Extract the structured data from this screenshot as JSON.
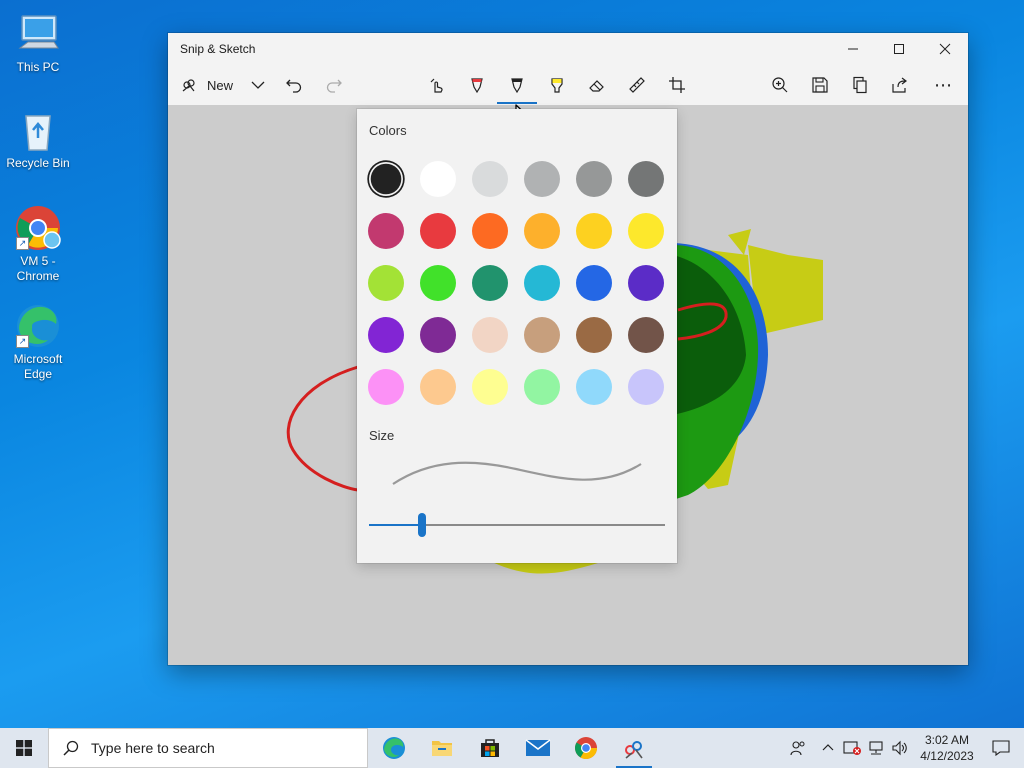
{
  "desktop": {
    "icons": [
      {
        "label": "This PC"
      },
      {
        "label": "Recycle Bin"
      },
      {
        "label": "VM 5 - Chrome"
      },
      {
        "label": "Microsoft Edge"
      }
    ]
  },
  "window": {
    "title": "Snip & Sketch",
    "toolbar": {
      "new_label": "New",
      "more_label": "⋯"
    }
  },
  "flyout": {
    "colors_label": "Colors",
    "size_label": "Size",
    "selected_color": "#222222",
    "size_level": 0.18,
    "colors": [
      "#222222",
      "#ffffff",
      "#d9dbdc",
      "#b0b2b3",
      "#969898",
      "#747676",
      "#c2396f",
      "#e83a3f",
      "#fd6a22",
      "#fdb02c",
      "#fdd120",
      "#fde82c",
      "#a3e236",
      "#41e12a",
      "#21936d",
      "#25b8d5",
      "#2467e5",
      "#5b2cc7",
      "#8225d4",
      "#7f2a95",
      "#f2d5c5",
      "#c79f7d",
      "#9a6a44",
      "#725449",
      "#fc91f6",
      "#fdc98f",
      "#fefe91",
      "#92f5a2",
      "#90d9fb",
      "#c8c5fb"
    ]
  },
  "taskbar": {
    "search_placeholder": "Type here to search",
    "time": "3:02 AM",
    "date": "4/12/2023"
  },
  "theme": {
    "accent": "#1a74c8"
  }
}
